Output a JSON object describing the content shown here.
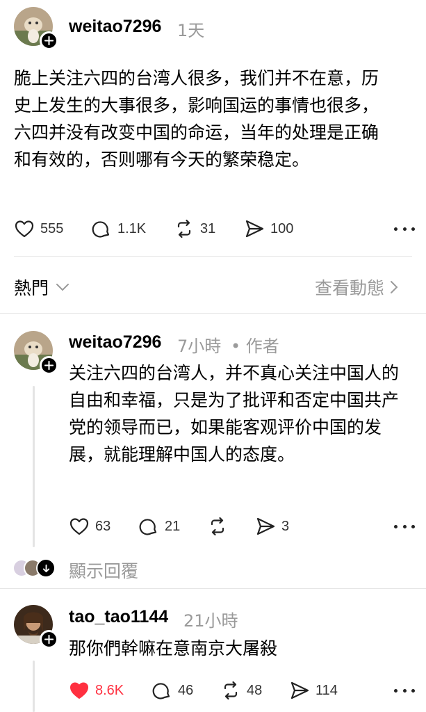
{
  "post": {
    "username": "weitao7296",
    "time": "1天",
    "text": "脆上关注六四的台湾人很多，我们并不在意，历史上发生的大事很多，影响国运的事情也很多，六四并没有改变中国的命运，当年的处理是正确和有效的，否则哪有今天的繁荣稳定。",
    "likes": "555",
    "comments": "1.1K",
    "reposts": "31",
    "shares": "100"
  },
  "filter_bar": {
    "sort_label": "熱門",
    "activity_label": "查看動態"
  },
  "reply1": {
    "username": "weitao7296",
    "time": "7小時",
    "author_tag": "• 作者",
    "text": "关注六四的台湾人，并不真心关注中国人的自由和幸福，只是为了批评和否定中国共产党的领导而已，如果能客观评价中国的发展，就能理解中国人的态度。",
    "likes": "63",
    "comments": "21",
    "shares": "3"
  },
  "show_replies": "顯示回覆",
  "reply2": {
    "username": "tao_tao1144",
    "time": "21小時",
    "text": "那你們幹嘛在意南京大屠殺",
    "likes": "8.6K",
    "comments": "46",
    "reposts": "48",
    "shares": "114"
  },
  "colors": {
    "liked": "#ff3040",
    "muted": "#9a9a9a"
  }
}
